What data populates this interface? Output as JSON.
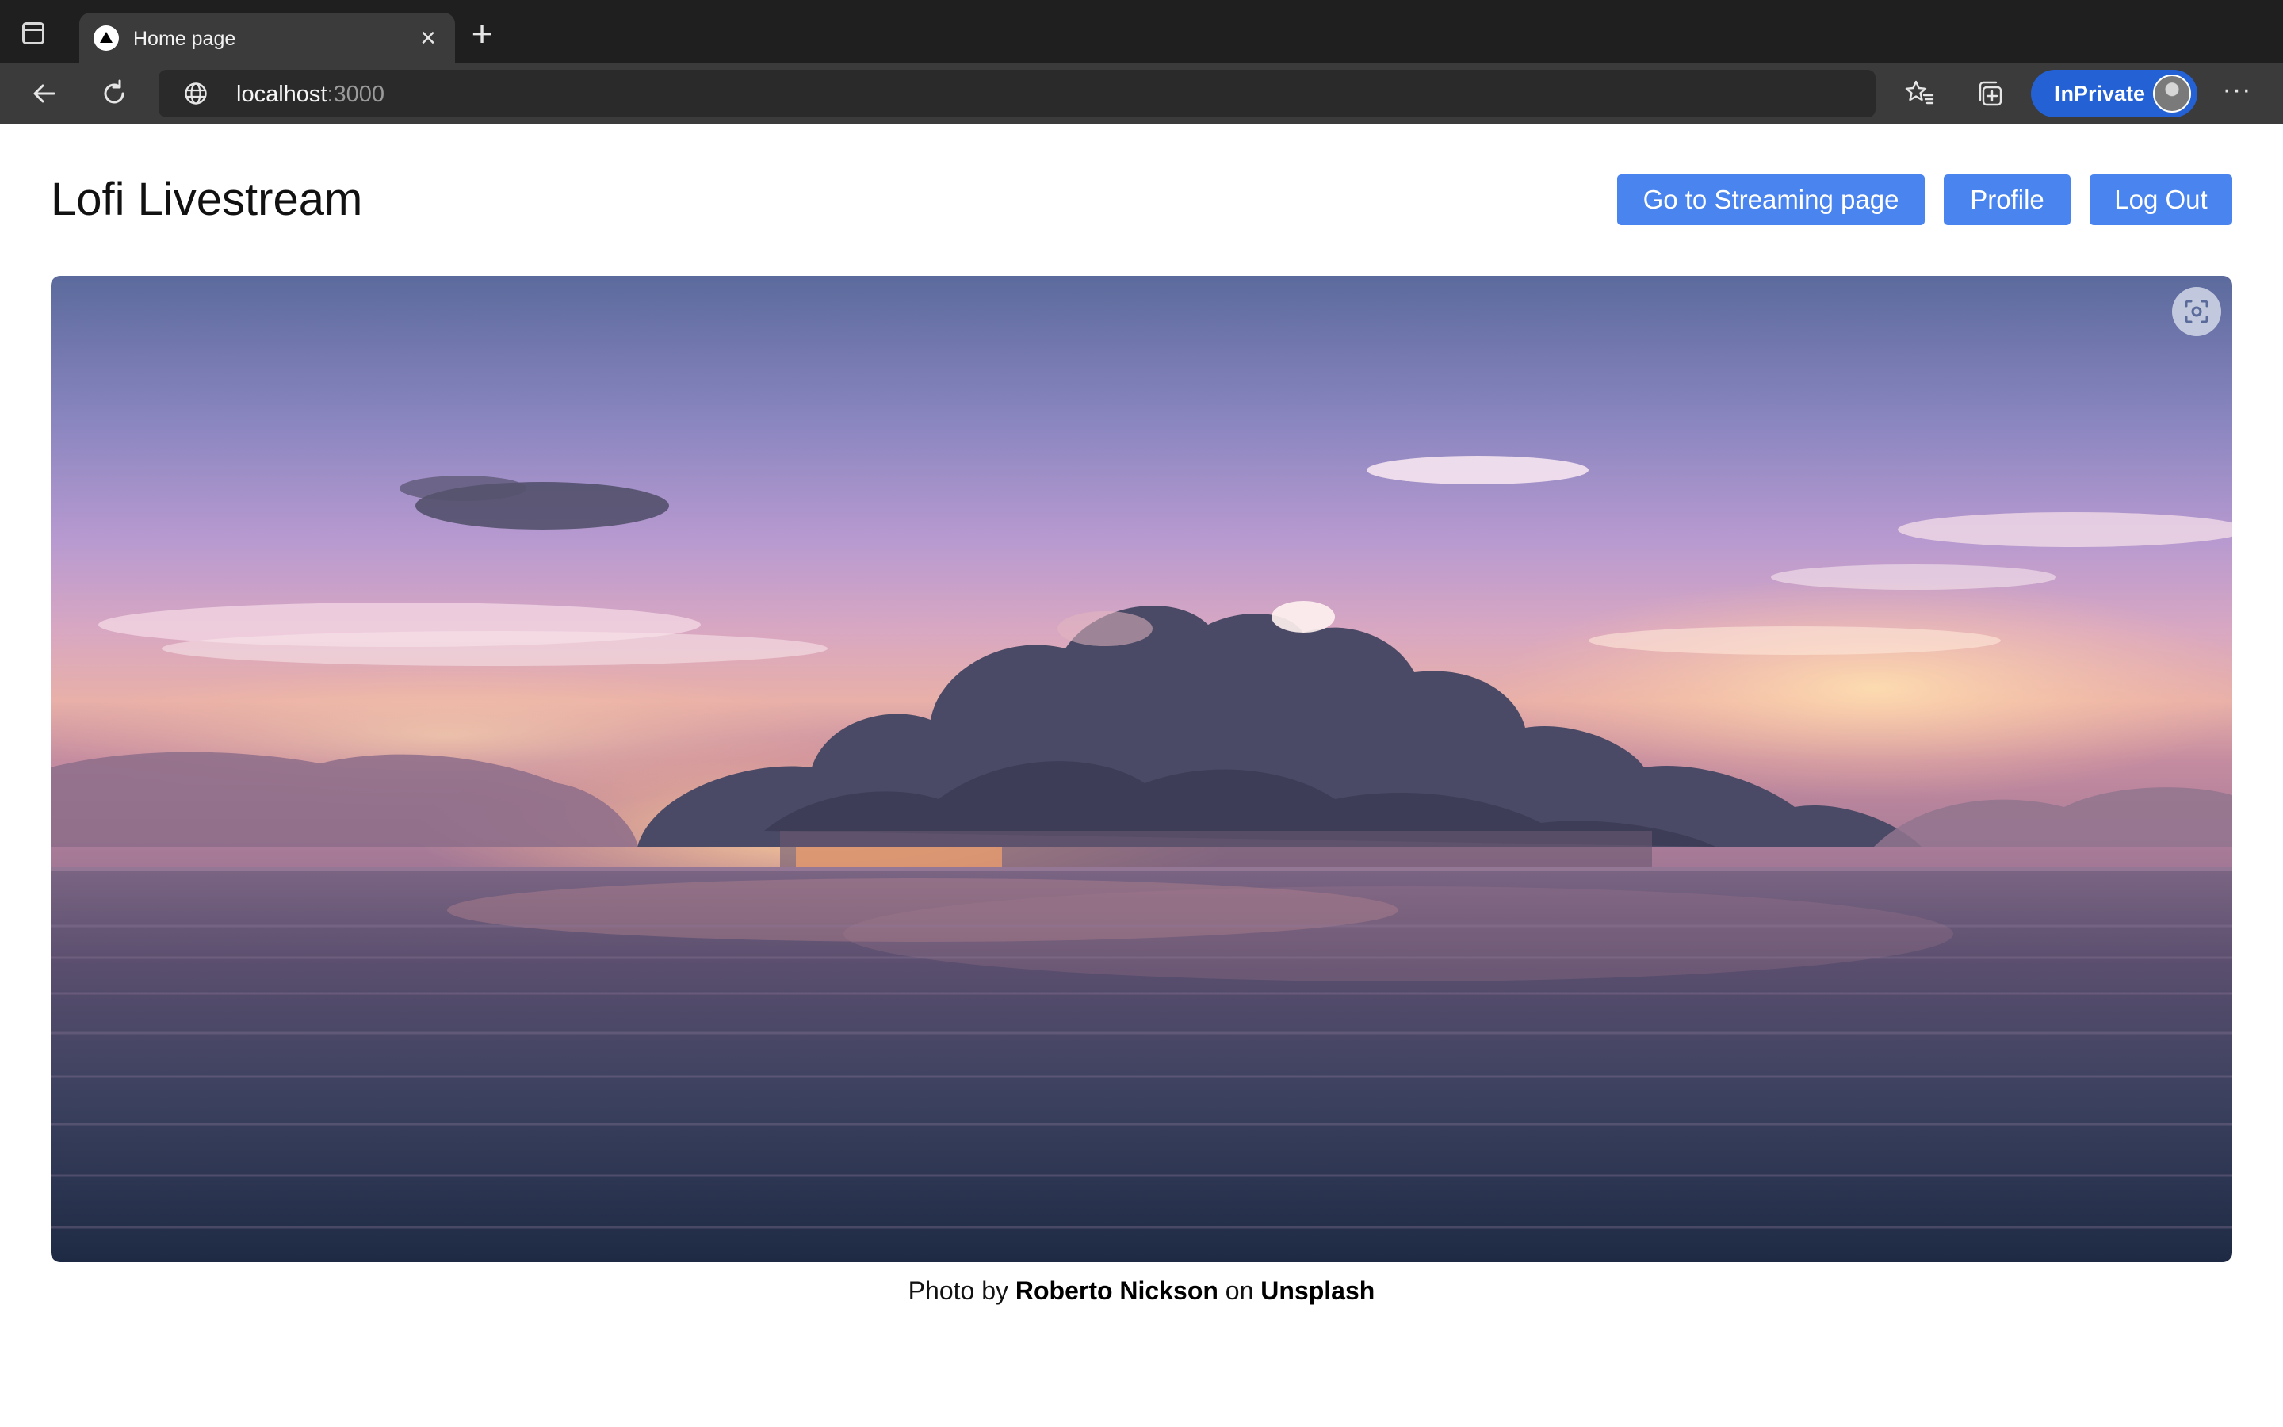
{
  "browser": {
    "tab": {
      "title": "Home page",
      "favicon": "triangle-logo-icon"
    },
    "address": {
      "host": "localhost",
      "port": ":3000"
    },
    "inprivate_label": "InPrivate",
    "icons": {
      "tab_actions": "tab-actions-icon",
      "close": "close-icon",
      "new_tab": "plus-icon",
      "back": "back-arrow-icon",
      "refresh": "refresh-icon",
      "site_info": "globe-icon",
      "favorites": "favorites-icon",
      "collections": "collections-icon",
      "more": "more-icon"
    }
  },
  "page": {
    "title": "Lofi Livestream",
    "buttons": {
      "streaming": "Go to Streaming page",
      "profile": "Profile",
      "logout": "Log Out"
    },
    "caption": {
      "prefix": "Photo by ",
      "author": "Roberto Nickson",
      "middle": " on ",
      "source": "Unsplash"
    }
  },
  "colors": {
    "button": "#4a84ee",
    "inprivate": "#2361d4",
    "chrome_dark": "#1f1f1f",
    "chrome_toolbar": "#3b3b3b"
  }
}
